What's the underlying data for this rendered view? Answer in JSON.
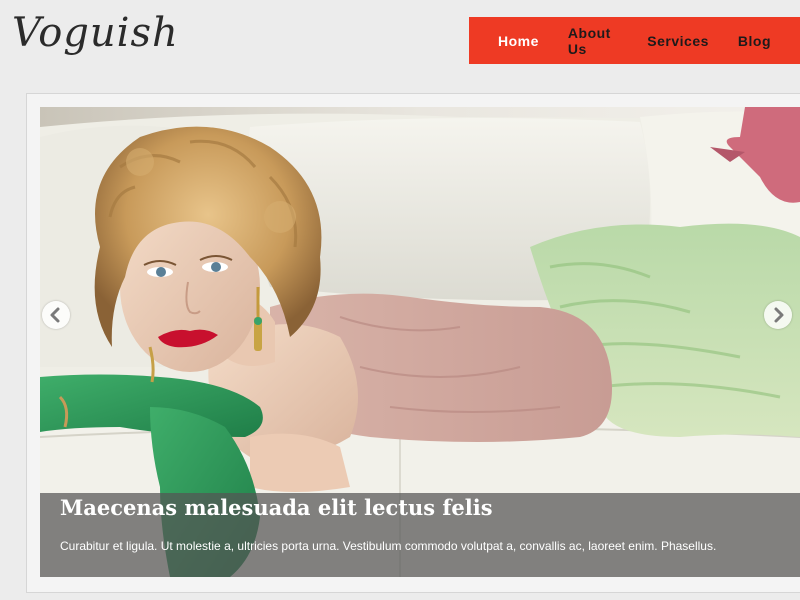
{
  "site": {
    "logo_text": "Voguish"
  },
  "nav": {
    "items": [
      {
        "label": "Home",
        "active": true
      },
      {
        "label": "About Us",
        "active": false
      },
      {
        "label": "Services",
        "active": false
      },
      {
        "label": "Blog",
        "active": false
      }
    ],
    "background_color": "#ee3a24"
  },
  "slider": {
    "caption_title": "Maecenas malesuada elit lectus felis",
    "caption_text": "Curabitur et ligula. Ut molestie a, ultricies porta urna. Vestibulum commodo volutpat a, convallis ac, laoreet enim. Phasellus.",
    "prev_icon": "chevron-left-icon",
    "next_icon": "chevron-right-icon"
  }
}
